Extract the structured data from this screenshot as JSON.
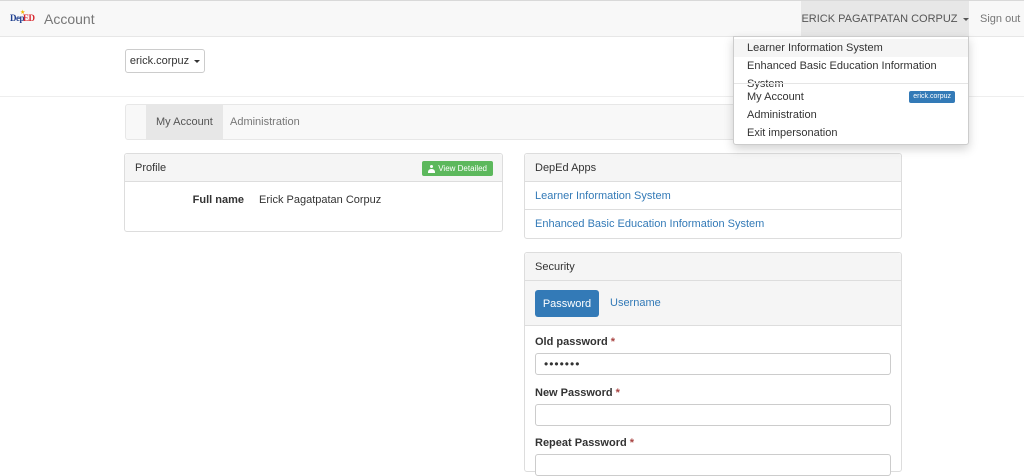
{
  "navbar": {
    "logo_dep": "Dep",
    "logo_ed": "ED",
    "title": "Account",
    "user_name": "ERICK PAGATPATAN CORPUZ",
    "sign_out": "Sign out"
  },
  "account_select": {
    "value": "erick.corpuz"
  },
  "tabs": {
    "my_account": "My Account",
    "administration": "Administration"
  },
  "profile": {
    "heading": "Profile",
    "view_button": "View Detailed",
    "full_name_label": "Full name",
    "full_name_value": "Erick Pagatpatan Corpuz"
  },
  "apps": {
    "heading": "DepEd Apps",
    "items": [
      "Learner Information System",
      "Enhanced Basic Education Information System"
    ]
  },
  "security": {
    "heading": "Security",
    "tab_password": "Password",
    "tab_username": "Username",
    "old_password_label": "Old password",
    "old_password_value": "•••••••",
    "new_password_label": "New Password",
    "repeat_password_label": "Repeat Password",
    "required_mark": "*"
  },
  "dropdown": {
    "items": [
      "Learner Information System",
      "Enhanced Basic Education Information System"
    ],
    "my_account": "My Account",
    "my_account_badge": "erick.corpuz",
    "administration": "Administration",
    "exit": "Exit impersonation"
  },
  "colors": {
    "primary": "#337ab7",
    "success": "#5cb85c",
    "navbar": "#f8f8f8",
    "required": "#a94442"
  }
}
